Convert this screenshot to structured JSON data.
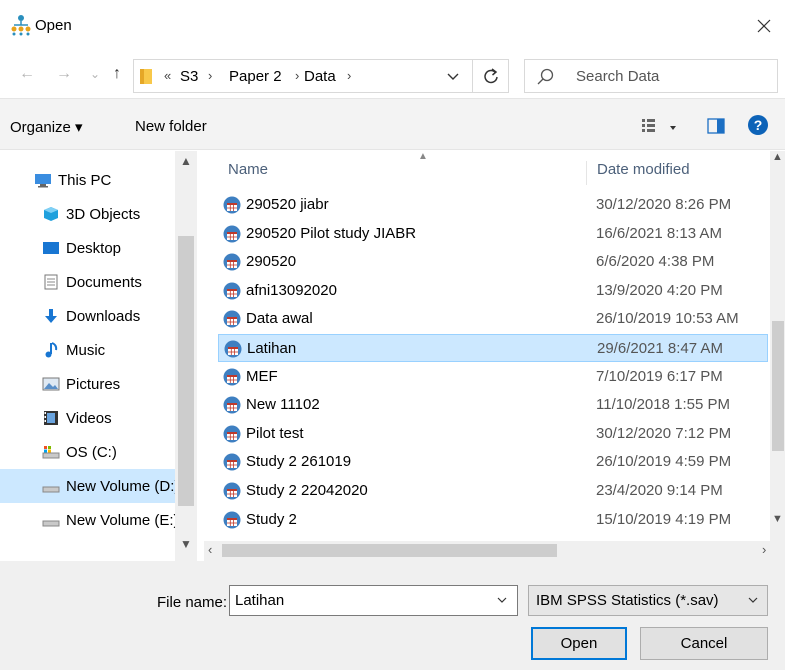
{
  "window": {
    "title": "Open",
    "close_glyph": "✕"
  },
  "nav": {
    "back_glyph": "←",
    "forward_glyph": "→",
    "recent_glyph": "⌄",
    "up_glyph": "↑",
    "overflow_glyph": "«",
    "breadcrumb": [
      "S3",
      "Paper 2",
      "Data"
    ],
    "separator_glyph": "›",
    "search_placeholder": "Search Data"
  },
  "toolbar": {
    "organize_label": "Organize ▾",
    "new_folder_label": "New folder",
    "help_label": "?"
  },
  "sidebar": {
    "items": [
      {
        "label": "This PC",
        "icon": "computer-icon"
      },
      {
        "label": "3D Objects",
        "icon": "3d-objects-icon"
      },
      {
        "label": "Desktop",
        "icon": "desktop-icon"
      },
      {
        "label": "Documents",
        "icon": "documents-icon"
      },
      {
        "label": "Downloads",
        "icon": "downloads-icon"
      },
      {
        "label": "Music",
        "icon": "music-icon"
      },
      {
        "label": "Pictures",
        "icon": "pictures-icon"
      },
      {
        "label": "Videos",
        "icon": "videos-icon"
      },
      {
        "label": "OS (C:)",
        "icon": "os-drive-icon"
      },
      {
        "label": "New Volume (D:)",
        "icon": "drive-icon",
        "selected": true
      },
      {
        "label": "New Volume (E:)",
        "icon": "drive-icon"
      }
    ]
  },
  "file_list": {
    "columns": {
      "name": "Name",
      "date": "Date modified"
    },
    "rows": [
      {
        "name": "290520 jiabr",
        "date": "30/12/2020 8:26 PM"
      },
      {
        "name": "290520 Pilot study JIABR",
        "date": "16/6/2021 8:13 AM"
      },
      {
        "name": "290520",
        "date": "6/6/2020 4:38 PM"
      },
      {
        "name": "afni13092020",
        "date": "13/9/2020 4:20 PM"
      },
      {
        "name": "Data awal",
        "date": "26/10/2019 10:53 AM"
      },
      {
        "name": "Latihan",
        "date": "29/6/2021 8:47 AM",
        "selected": true
      },
      {
        "name": "MEF",
        "date": "7/10/2019 6:17 PM"
      },
      {
        "name": "New 11102",
        "date": "11/10/2018 1:55 PM"
      },
      {
        "name": "Pilot test",
        "date": "30/12/2020 7:12 PM"
      },
      {
        "name": "Study 2 261019",
        "date": "26/10/2019 4:59 PM"
      },
      {
        "name": "Study 2 22042020",
        "date": "23/4/2020 9:14 PM"
      },
      {
        "name": "Study 2",
        "date": "15/10/2019 4:19 PM"
      }
    ]
  },
  "footer": {
    "file_name_label": "File name:",
    "file_name_value": "Latihan",
    "file_type_value": "IBM SPSS Statistics (*.sav)",
    "open_label": "Open",
    "cancel_label": "Cancel"
  },
  "colors": {
    "selection": "#cce8ff",
    "accent": "#0078d7",
    "folder": "#f8c84a"
  }
}
